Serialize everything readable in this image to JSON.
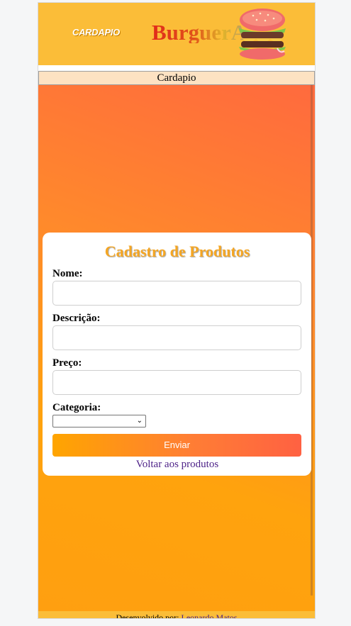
{
  "header": {
    "logo_text": "CARDAPIO",
    "brand": "BurguerA"
  },
  "title_bar": {
    "text": "Cardapio"
  },
  "form": {
    "title": "Cadastro de Produtos",
    "fields": [
      {
        "label": "Nome:",
        "value": "",
        "placeholder": ""
      },
      {
        "label": "Descrição:",
        "value": "",
        "placeholder": ""
      },
      {
        "label": "Preço:",
        "value": "",
        "placeholder": ""
      }
    ],
    "category": {
      "label": "Categoria:",
      "selected": ""
    },
    "submit_label": "Enviar",
    "back_link": "Voltar aos produtos"
  },
  "footer": {
    "text": "Desenvolvido por:",
    "author": "Leonardo Matos"
  },
  "colors": {
    "header_bg": "#fbbd38",
    "title_bar_bg": "#fde2c2",
    "gradient_start": "#ff6a3e",
    "gradient_end": "#ffa30d",
    "form_title": "#f5a623",
    "link": "#4b1f86"
  },
  "icons": {
    "header_image": "burger-icon",
    "select_arrow": "chevron-down-icon"
  }
}
